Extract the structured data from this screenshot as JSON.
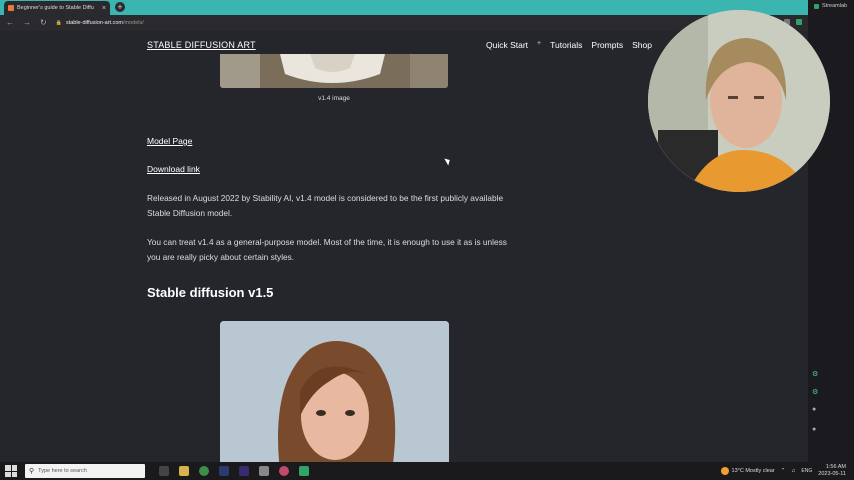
{
  "browser": {
    "tab_title": "Beginner's guide to Stable Diffu",
    "tab_close": "×",
    "new_tab": "+",
    "url_domain": "stable-diffusion-art.com",
    "url_path": "/models/"
  },
  "side_app": {
    "label": "Streamlab"
  },
  "site": {
    "title": "STABLE DIFFUSION ART",
    "nav": {
      "quick_start": "Quick Start",
      "plus": "+",
      "tutorials": "Tutorials",
      "prompts": "Prompts",
      "shop": "Shop"
    }
  },
  "content": {
    "caption": "v1.4 image",
    "model_page": "Model Page",
    "download_link": "Download link",
    "para1": "Released in August 2022 by Stability AI, v1.4 model is considered to be the first publicly available Stable Diffusion model.",
    "para2": "You can treat v1.4 as a general-purpose model. Most of the time, it is enough to use it as is unless you are really picky about certain styles.",
    "heading": "Stable diffusion v1.5"
  },
  "taskbar": {
    "search_placeholder": "Type here to search",
    "weather": "13°C  Mostly clear",
    "lang": "ENG",
    "time": "1:56 AM",
    "date": "2023-05-11"
  },
  "colors": {
    "tabbar": "#3bb5b0",
    "page_bg": "#25262b",
    "accent_green": "#2fa36b"
  }
}
